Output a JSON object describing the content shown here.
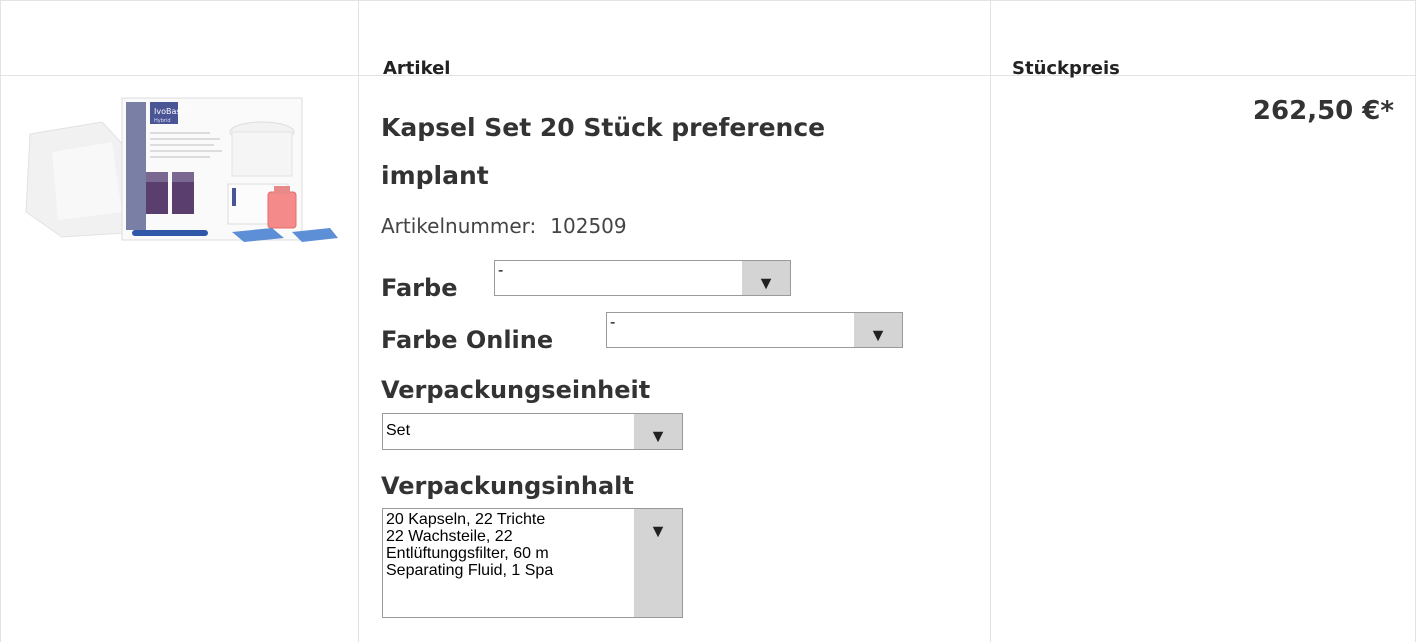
{
  "table": {
    "header": {
      "article": "Artikel",
      "unit_price": "Stückpreis"
    }
  },
  "product": {
    "image_icon": "product-box-image",
    "title": "Kapsel Set 20 Stück preference implant",
    "article_number_label": "Artikelnummer:",
    "article_number": "102509",
    "price": "262,50 €*",
    "options": {
      "farbe": {
        "label": "Farbe",
        "value": "-"
      },
      "farbe_online": {
        "label": "Farbe Online",
        "value": "-"
      },
      "verpackungseinheit": {
        "label": "Verpackungseinheit",
        "value": "Set"
      },
      "verpackungsinhalt": {
        "label": "Verpackungsinhalt",
        "lines": [
          "20 Kapseln, 22 Trichte",
          "22 Wachsteile, 22",
          "Entlüftunggsfilter, 60 m",
          "Separating Fluid, 1 Spa"
        ]
      }
    }
  },
  "colors": {
    "border": "#e3e3e3",
    "arrow_bg": "#d4d4d4",
    "text": "#333333"
  }
}
